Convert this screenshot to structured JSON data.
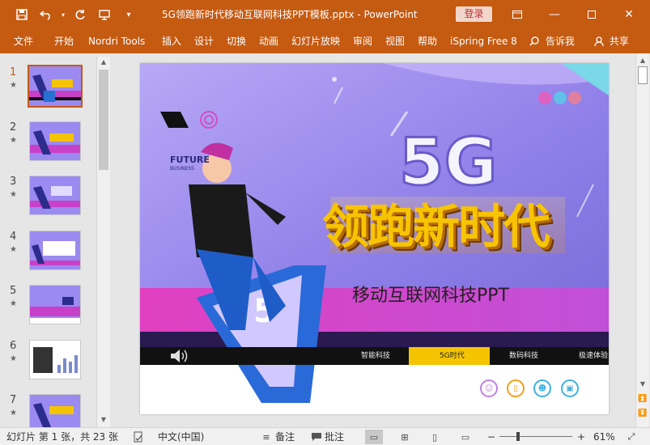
{
  "window": {
    "title": "5G领跑新时代移动互联网科技PPT模板.pptx  -  PowerPoint",
    "login_label": "登录",
    "colors": {
      "accent": "#c55a11",
      "chrome": "#e6e6e6"
    }
  },
  "qat": {
    "save_icon": "save-icon",
    "undo_icon": "undo-icon",
    "redo_icon": "redo-icon",
    "present_icon": "present-from-start-icon",
    "customize_icon": "customize-qat-icon"
  },
  "ribbon": {
    "tabs": [
      "文件",
      "开始",
      "Nordri Tools",
      "插入",
      "设计",
      "切换",
      "动画",
      "幻灯片放映",
      "审阅",
      "视图",
      "帮助",
      "iSpring Free 8"
    ],
    "tell_me": "告诉我",
    "share": "共享"
  },
  "thumbnails": [
    {
      "num": "1",
      "star": "★"
    },
    {
      "num": "2",
      "star": "★"
    },
    {
      "num": "3",
      "star": "★"
    },
    {
      "num": "4",
      "star": "★"
    },
    {
      "num": "5",
      "star": "★"
    },
    {
      "num": "6",
      "star": "★"
    },
    {
      "num": "7",
      "star": "★"
    }
  ],
  "slide": {
    "headline_5g": "5G",
    "headline": "领跑新时代",
    "subtitle": "移动互联网科技PPT",
    "future_label": "FUTURE",
    "business_label": "BUSINESS",
    "band_items": [
      "智能科技",
      "5G时代",
      "数码科技",
      "极速体验"
    ],
    "colors": {
      "purple": "#8a7be0",
      "pink": "#d04fd0",
      "yellow": "#f5c400",
      "band": "#111111"
    }
  },
  "status": {
    "slide_info": "幻灯片 第 1 张，共 23 张",
    "language": "中文(中国)",
    "notes": "备注",
    "comments": "批注",
    "zoom": "61%"
  }
}
